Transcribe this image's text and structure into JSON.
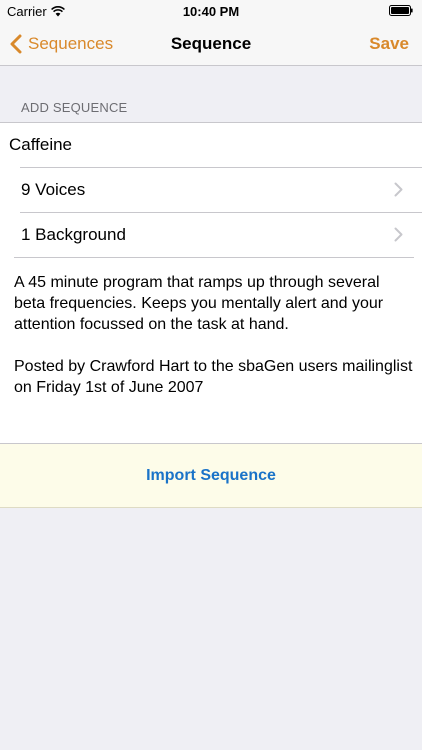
{
  "status_bar": {
    "carrier": "Carrier",
    "time": "10:40 PM"
  },
  "nav": {
    "back_label": "Sequences",
    "title": "Sequence",
    "save_label": "Save"
  },
  "section_header": "ADD SEQUENCE",
  "sequence": {
    "name": "Caffeine",
    "rows": [
      {
        "label": "9 Voices",
        "icon": "chevron-right-icon"
      },
      {
        "label": "1 Background",
        "icon": "chevron-right-icon"
      }
    ],
    "description": [
      "A 45 minute program that ramps up through several beta frequencies. Keeps you mentally alert and your attention focussed on the task at hand.",
      "Posted by Crawford Hart to the sbaGen users mailinglist on Friday 1st of June 2007"
    ]
  },
  "import_label": "Import Sequence",
  "colors": {
    "accent": "#d9892b",
    "link": "#1a73c8",
    "import_background": "#fdfce9",
    "background": "#efeff4"
  }
}
